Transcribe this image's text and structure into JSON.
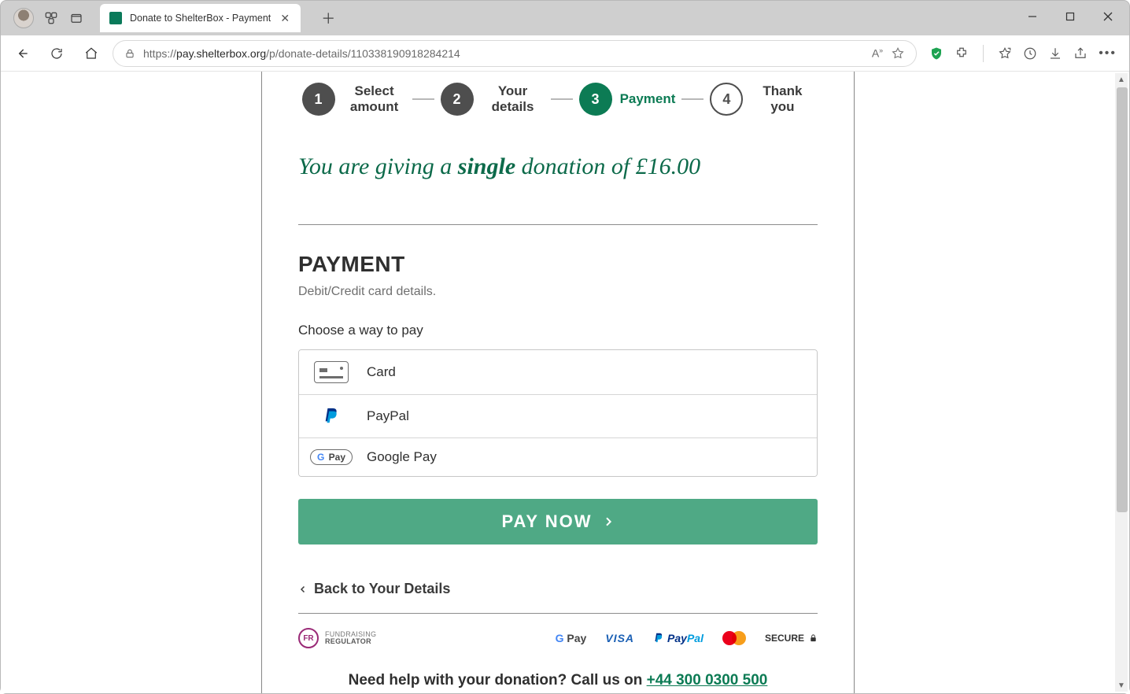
{
  "browser": {
    "tab_title": "Donate to ShelterBox - Payment",
    "url_prefix": "https://",
    "url_host": "pay.shelterbox.org",
    "url_path": "/p/donate-details/110338190918284214"
  },
  "stepper": {
    "steps": [
      {
        "num": "1",
        "label": "Select amount"
      },
      {
        "num": "2",
        "label": "Your details"
      },
      {
        "num": "3",
        "label": "Payment"
      },
      {
        "num": "4",
        "label": "Thank you"
      }
    ]
  },
  "summary": {
    "pre": "You are giving a ",
    "bold": "single",
    "post": " donation of £16.00"
  },
  "payment": {
    "heading": "PAYMENT",
    "sub": "Debit/Credit card details.",
    "choose": "Choose a way to pay",
    "options": {
      "card": "Card",
      "paypal": "PayPal",
      "gpay": "Google Pay"
    },
    "paynow": "PAY NOW"
  },
  "back": "Back to Your Details",
  "footer": {
    "fr_small": "FUNDRAISING",
    "fr_bold": "REGULATOR",
    "gpay": "G Pay",
    "visa": "VISA",
    "paypal": "PayPal",
    "secure": "SECURE",
    "help_pre": "Need help with your donation? Call us on ",
    "help_phone": "+44 300 0300 500"
  }
}
